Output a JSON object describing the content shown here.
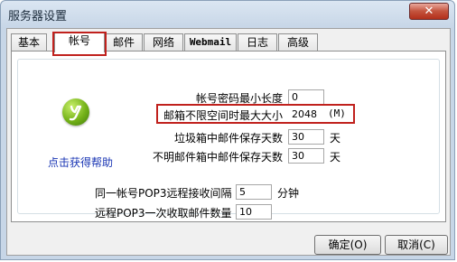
{
  "window": {
    "title": "服务器设置",
    "close": "✕"
  },
  "tabs": [
    "基本",
    "帐号",
    "邮件",
    "网络",
    "Webmail",
    "日志",
    "高级"
  ],
  "help": {
    "link_text": "点击获得帮助"
  },
  "fields": {
    "min_password_len": {
      "label": "帐号密码最小长度",
      "value": "0"
    },
    "max_mailbox_size": {
      "label": "邮箱不限空间时最大大小",
      "value": "2048",
      "unit": "(M)"
    },
    "trash_keep_days": {
      "label": "垃圾箱中邮件保存天数",
      "value": "30",
      "unit": "天"
    },
    "unknown_keep_days": {
      "label": "不明邮件箱中邮件保存天数",
      "value": "30",
      "unit": "天"
    },
    "pop3_interval": {
      "label": "同一帐号POP3远程接收间隔",
      "value": "5",
      "unit": "分钟"
    },
    "pop3_count": {
      "label": "远程POP3一次收取邮件数量",
      "value": "10"
    }
  },
  "buttons": {
    "ok": "确定(O)",
    "cancel": "取消(C)"
  }
}
